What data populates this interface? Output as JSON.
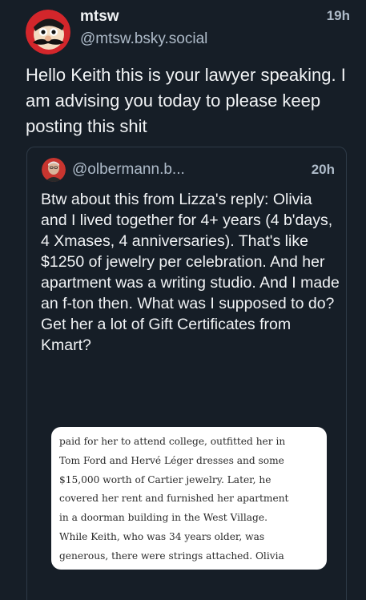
{
  "post": {
    "author": {
      "display_name": "mtsw",
      "handle": "@mtsw.bsky.social"
    },
    "timestamp": "19h",
    "text": "Hello Keith this is your lawyer speaking. I am advising you today to please keep posting this shit",
    "quote": {
      "handle": "@olbermann.b...",
      "timestamp": "20h",
      "text": "Btw about this from Lizza's reply: Olivia and I lived together for 4+ years (4 b'days, 4 Xmases, 4 anniversaries). That's like $1250 of jewelry per celebration. And her apartment was a writing studio. And I made an f-ton then. What was I supposed to do? Get her a lot of Gift Certificates from Kmart?",
      "image_text_lines": [
        "paid for her to attend college, outfitted her in",
        "Tom Ford and Hervé Léger dresses and some",
        "$15,000 worth of Cartier jewelry. Later, he",
        "covered her rent and furnished her apartment",
        "in a doorman building in the West Village.",
        "While Keith, who was 34 years older, was",
        "generous, there were strings attached. Olivia"
      ]
    }
  },
  "colors": {
    "background": "#161e27",
    "text_primary": "#f1f3f5",
    "text_secondary": "#aebbc9",
    "border": "#2e3a47",
    "avatar_red": "#e02424"
  }
}
